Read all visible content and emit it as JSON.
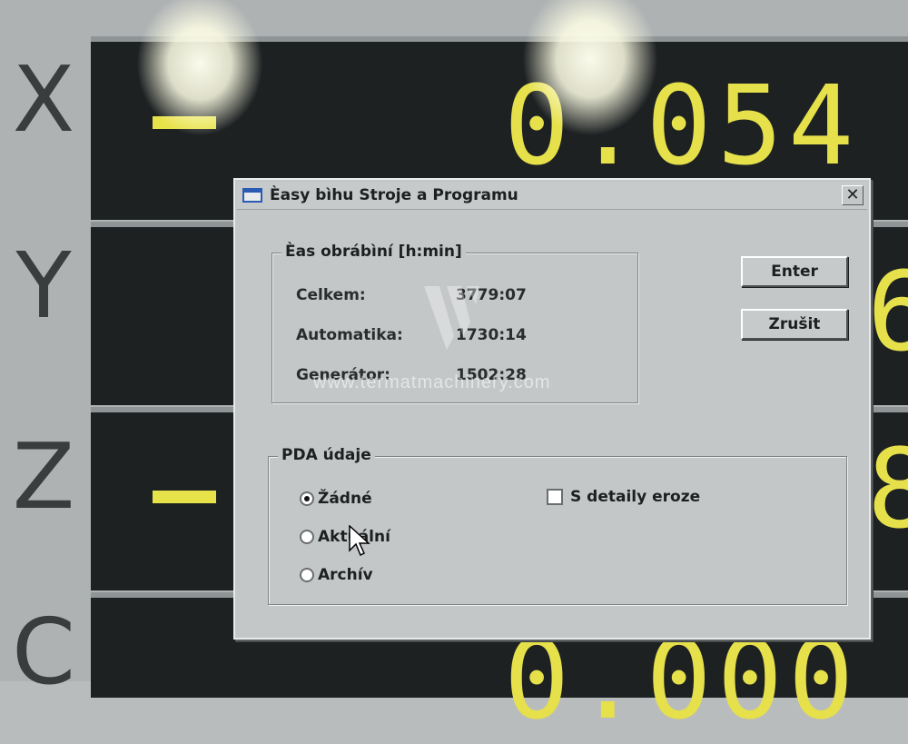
{
  "dro": {
    "axes": [
      {
        "letter": "X",
        "sign": "-",
        "value": "0.054"
      },
      {
        "letter": "Y",
        "sign": "",
        "value": "6"
      },
      {
        "letter": "Z",
        "sign": "-",
        "value": "8"
      },
      {
        "letter": "C",
        "sign": "",
        "value": "0.000"
      }
    ]
  },
  "dialog": {
    "title": "Èasy bìhu Stroje a Programu",
    "close_label": "✕",
    "time_group": {
      "label": "Èas obrábìní [h:min]",
      "rows": [
        {
          "label": "Celkem:",
          "value": "3779:07"
        },
        {
          "label": "Automatika:",
          "value": "1730:14"
        },
        {
          "label": "Generátor:",
          "value": "1502:28"
        }
      ]
    },
    "buttons": {
      "enter": "Enter",
      "cancel": "Zrušit"
    },
    "pda_group": {
      "label": "PDA údaje",
      "options": [
        {
          "label": "Žádné",
          "checked": true
        },
        {
          "label": "Aktuální",
          "checked": false
        },
        {
          "label": "Archív",
          "checked": false
        }
      ],
      "checkbox": {
        "label": "S detaily eroze",
        "checked": false
      }
    }
  },
  "watermark": "www.termatmachinery.com"
}
